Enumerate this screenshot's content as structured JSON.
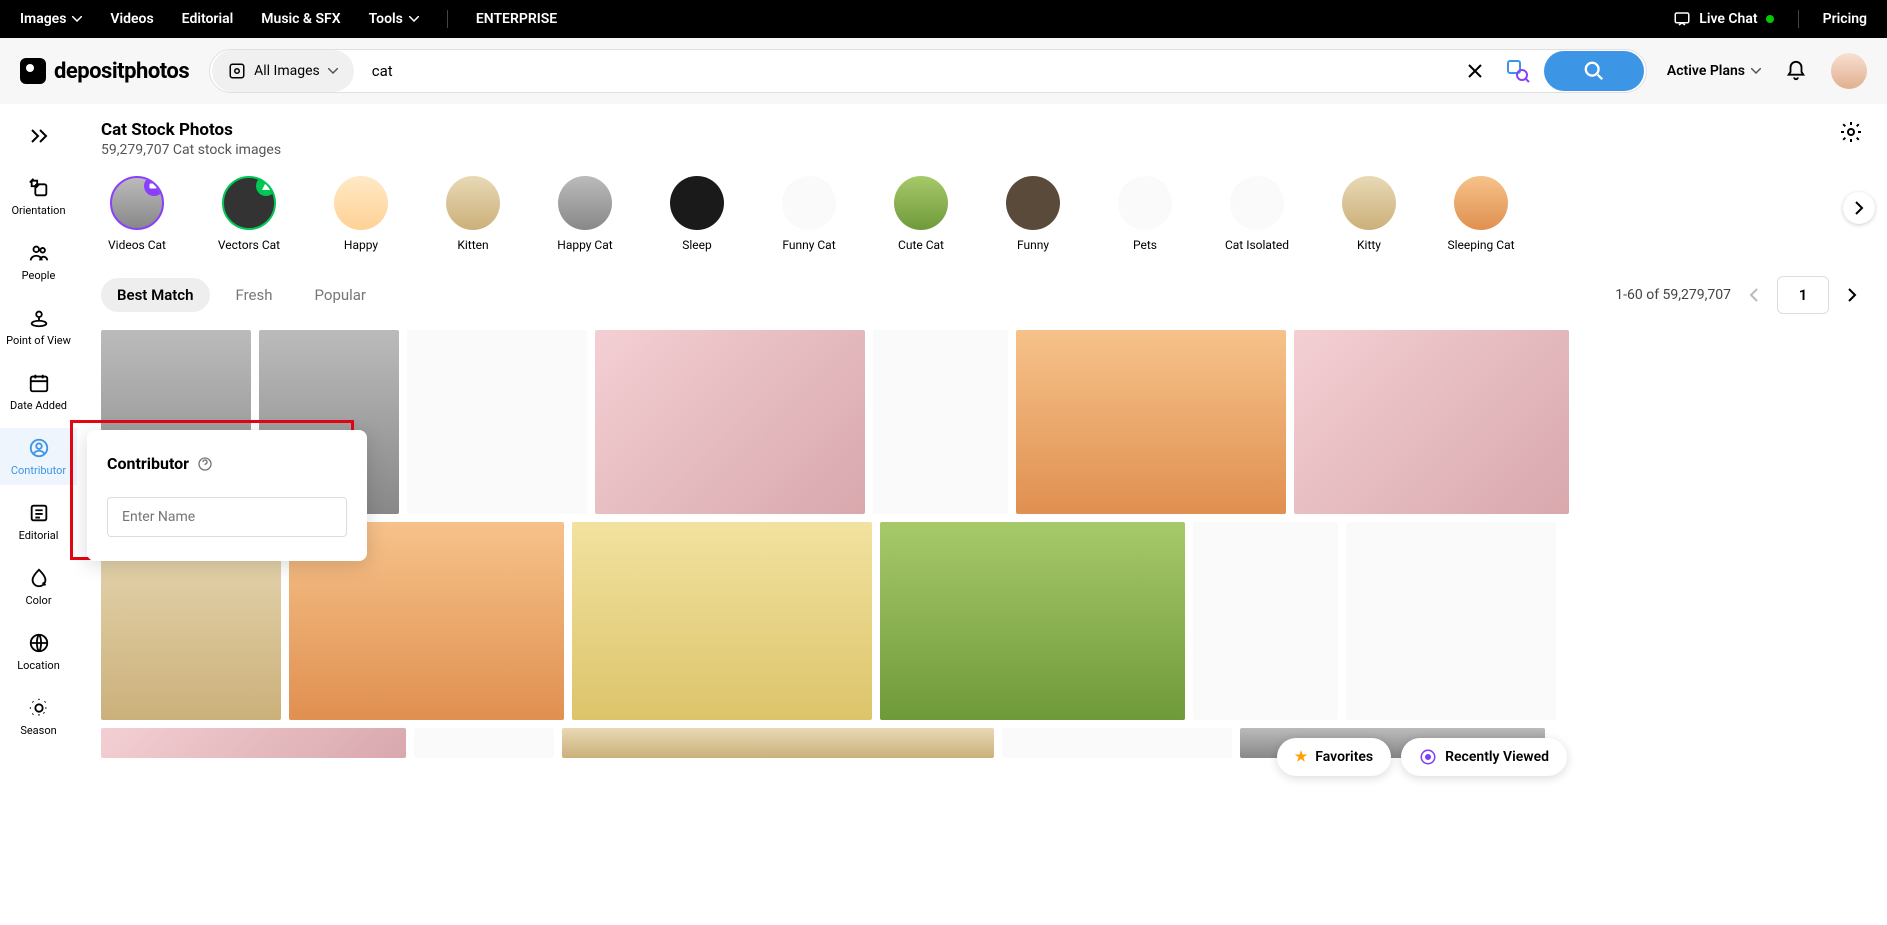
{
  "topnav": {
    "images": "Images",
    "videos": "Videos",
    "editorial": "Editorial",
    "music": "Music & SFX",
    "tools": "Tools",
    "enterprise": "ENTERPRISE",
    "live_chat": "Live Chat",
    "pricing": "Pricing"
  },
  "brand": "depositphotos",
  "search": {
    "type": "All Images",
    "value": "cat"
  },
  "header": {
    "active_plans": "Active Plans"
  },
  "filters": {
    "orientation": "Orientation",
    "people": "People",
    "pov": "Point of View",
    "date_added": "Date Added",
    "contributor": "Contributor",
    "editorial": "Editorial",
    "color": "Color",
    "location": "Location",
    "season": "Season"
  },
  "page": {
    "title": "Cat Stock Photos",
    "subtitle": "59,279,707 Cat stock images"
  },
  "related": [
    {
      "label": "Videos Cat"
    },
    {
      "label": "Vectors Cat"
    },
    {
      "label": "Happy"
    },
    {
      "label": "Kitten"
    },
    {
      "label": "Happy Cat"
    },
    {
      "label": "Sleep"
    },
    {
      "label": "Funny Cat"
    },
    {
      "label": "Cute Cat"
    },
    {
      "label": "Funny"
    },
    {
      "label": "Pets"
    },
    {
      "label": "Cat Isolated"
    },
    {
      "label": "Kitty"
    },
    {
      "label": "Sleeping Cat"
    }
  ],
  "sort": {
    "best_match": "Best Match",
    "fresh": "Fresh",
    "popular": "Popular"
  },
  "pagination": {
    "range": "1-60 of 59,279,707",
    "current": "1"
  },
  "popout": {
    "title": "Contributor",
    "placeholder": "Enter Name"
  },
  "bottom": {
    "favorites": "Favorites",
    "recent": "Recently Viewed"
  },
  "chart_data": null
}
